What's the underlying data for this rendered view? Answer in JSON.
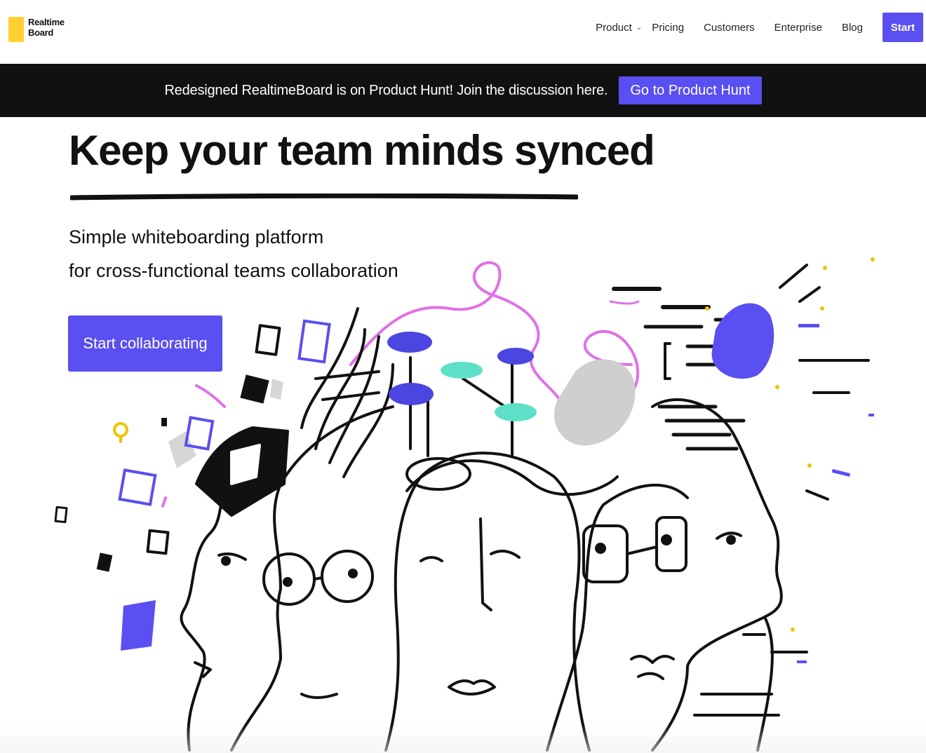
{
  "header": {
    "logo": {
      "line1": "Realtime",
      "line2": "Board",
      "color": "#FFD02F"
    },
    "nav": [
      {
        "label": "Product",
        "has_dropdown": true
      },
      {
        "label": "Pricing"
      },
      {
        "label": "Customers"
      },
      {
        "label": "Enterprise"
      },
      {
        "label": "Blog"
      }
    ],
    "start_label": "Start"
  },
  "banner": {
    "text": "Redesigned RealtimeBoard is on Product Hunt! Join the discussion here.",
    "button_label": "Go to Product Hunt"
  },
  "hero": {
    "title": "Keep your team minds synced",
    "subtitle_line1": "Simple whiteboarding platform",
    "subtitle_line2": "for cross-functional teams collaboration",
    "cta_label": "Start collaborating"
  },
  "colors": {
    "accent": "#5A4FF0",
    "brand_yellow": "#FFD02F",
    "banner_bg": "#111111",
    "illustration_pink": "#E070E8",
    "illustration_teal": "#5EE0C8"
  },
  "icons": [
    "chevron-down-icon",
    "logo-mark-icon"
  ]
}
